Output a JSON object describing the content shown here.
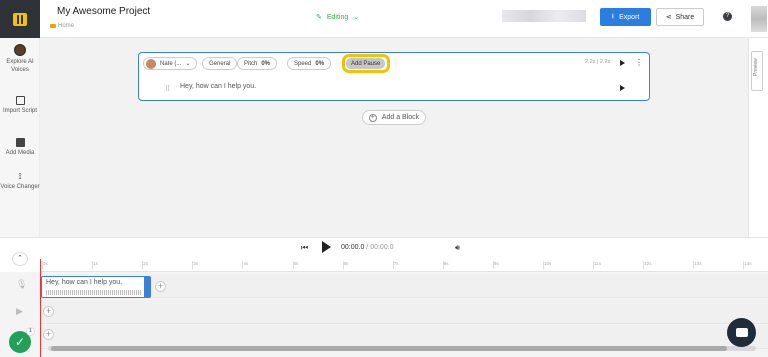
{
  "header": {
    "project_title": "My Awesome Project",
    "breadcrumb": "Home",
    "mode_label": "Editing",
    "export_label": "Export",
    "share_label": "Share",
    "help_label": "?"
  },
  "sidebar": {
    "items": [
      {
        "label": "Explore AI Voices",
        "icon": "voice-avatar-icon"
      },
      {
        "label": "Import Script",
        "icon": "import-script-icon"
      },
      {
        "label": "Add Media",
        "icon": "add-media-icon"
      },
      {
        "label": "Voice Changer",
        "icon": "voice-changer-icon"
      }
    ]
  },
  "block": {
    "voice_name": "Nate (...",
    "style_label": "General",
    "pitch_label": "Pitch",
    "pitch_value": "0%",
    "speed_label": "Speed",
    "speed_value": "0%",
    "add_pause_label": "Add Pause",
    "duration": "2.2s | 2.2s",
    "line_text": "Hey, how can I help you."
  },
  "add_block_label": "Add a Block",
  "preview_label": "Preview",
  "player": {
    "current_time": "00:00.0",
    "separator": " / ",
    "total_time": "00:00.0"
  },
  "timeline": {
    "ticks": [
      "0s",
      "1s",
      "2s",
      "3s",
      "4s",
      "5s",
      "6s",
      "7s",
      "8s",
      "9s",
      "10s",
      "11s",
      "12s",
      "13s",
      "14s"
    ],
    "clip_text": "Hey, how can I help you."
  },
  "status": {
    "badge_count": "1"
  },
  "colors": {
    "accent": "#2a7de1",
    "brand_yellow": "#f2c300",
    "editing_green": "#3aa657",
    "playhead_red": "#e33333"
  }
}
